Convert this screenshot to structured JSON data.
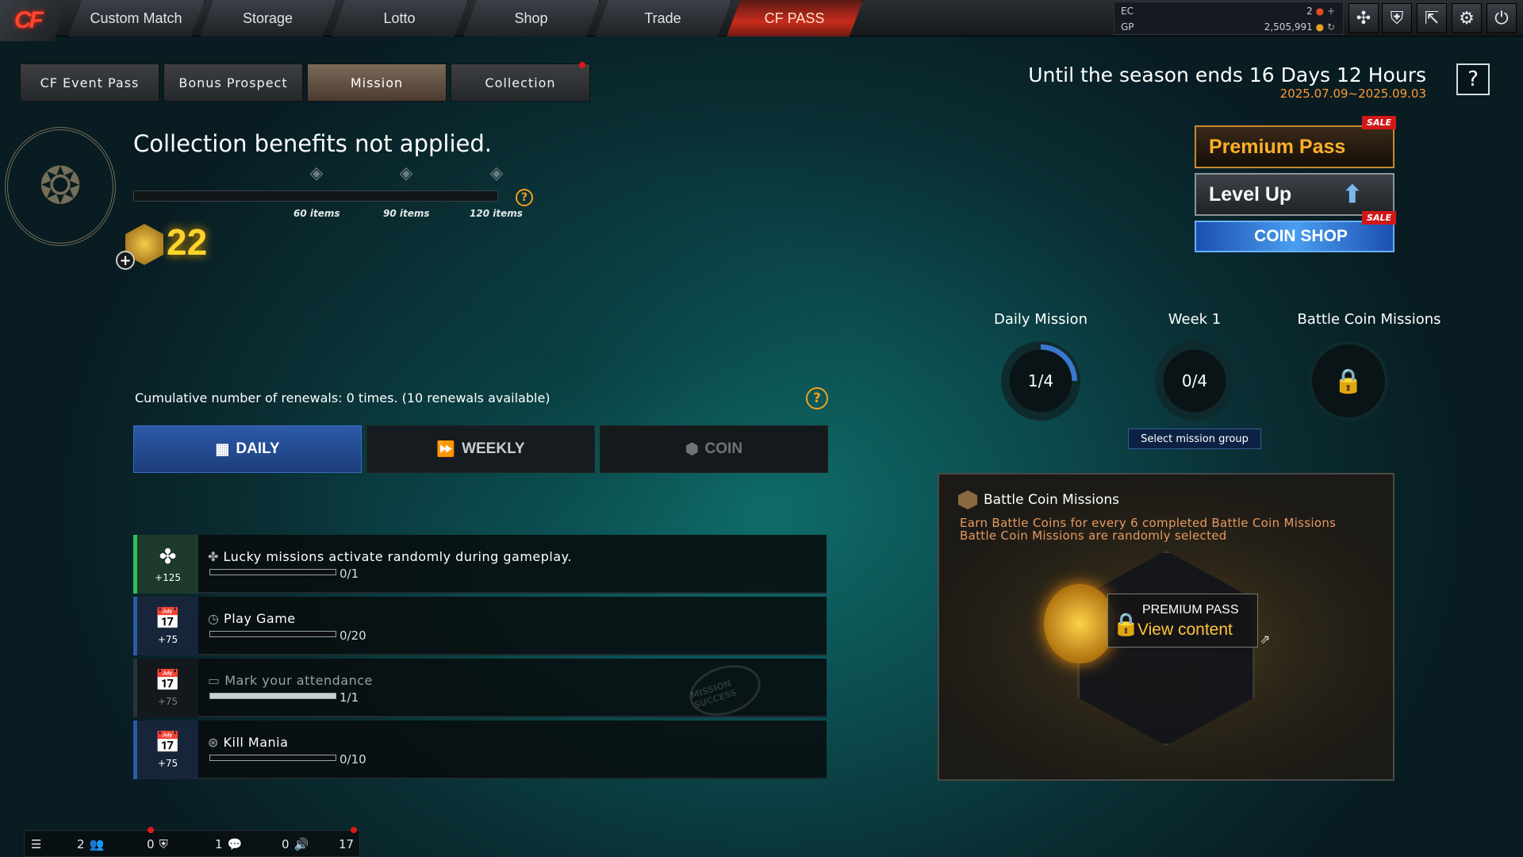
{
  "topnav": {
    "logo": "CF",
    "tabs": [
      "Custom Match",
      "Storage",
      "Lotto",
      "Shop",
      "Trade",
      "CF PASS"
    ],
    "active": "CF PASS"
  },
  "wallet": {
    "ec_label": "EC",
    "ec_value": "2",
    "gp_label": "GP",
    "gp_value": "2,505,991"
  },
  "toolbar_icons": [
    "clan-icon",
    "shield-icon",
    "exit-icon",
    "settings-icon",
    "power-icon"
  ],
  "subtabs": [
    "CF Event Pass",
    "Bonus Prospect",
    "Mission",
    "Collection"
  ],
  "season": {
    "ends": "Until the season ends 16 Days 12 Hours",
    "dates": "2025.07.09~2025.09.03",
    "help": "?"
  },
  "collection": {
    "title": "Collection benefits not applied.",
    "marks": [
      "60 items",
      "90 items",
      "120 items"
    ],
    "count": "22",
    "help": "?",
    "plus": "+"
  },
  "renewals": {
    "text": "Cumulative number of renewals: 0 times. (10 renewals available)",
    "help": "?"
  },
  "mission_tabs": {
    "daily": "DAILY",
    "weekly": "WEEKLY",
    "coin": "COIN"
  },
  "missions": [
    {
      "name": "Lucky missions activate randomly during gameplay.",
      "points": "+125",
      "progress": "0/1",
      "fraction": 0.0
    },
    {
      "name": "Play Game",
      "points": "+75",
      "progress": "0/20",
      "fraction": 0.0
    },
    {
      "name": "Mark your attendance",
      "points": "+75",
      "progress": "1/1",
      "fraction": 1.0,
      "stamp": "MISSION SUCCESS"
    },
    {
      "name": "Kill Mania",
      "points": "+75",
      "progress": "0/10",
      "fraction": 0.0
    }
  ],
  "right": {
    "premium": "Premium Pass",
    "levelup": "Level Up",
    "coinshop": "COIN SHOP",
    "sale": "SALE",
    "groups": [
      {
        "title": "Daily Mission",
        "value": "1/4",
        "fraction": 0.25
      },
      {
        "title": "Week 1",
        "value": "0/4",
        "fraction": 0.0
      },
      {
        "title": "Battle Coin Missions",
        "value": ""
      }
    ],
    "select_group": "Select mission group"
  },
  "battle_coin": {
    "title": "Battle Coin Missions",
    "desc1": "Earn Battle Coins for every 6 completed Battle Coin Missions",
    "desc2": "Battle Coin Missions are randomly selected",
    "premium_pass": "PREMIUM PASS",
    "view": "View content"
  },
  "bottom": {
    "v1": "2",
    "v2": "0",
    "v3": "1",
    "v4": "0",
    "v5": "17"
  },
  "colors": {
    "accent": "#c82b1c",
    "daily_tab": "#2d5aa8",
    "gold": "#ffd42a",
    "sale": "#d01818"
  }
}
